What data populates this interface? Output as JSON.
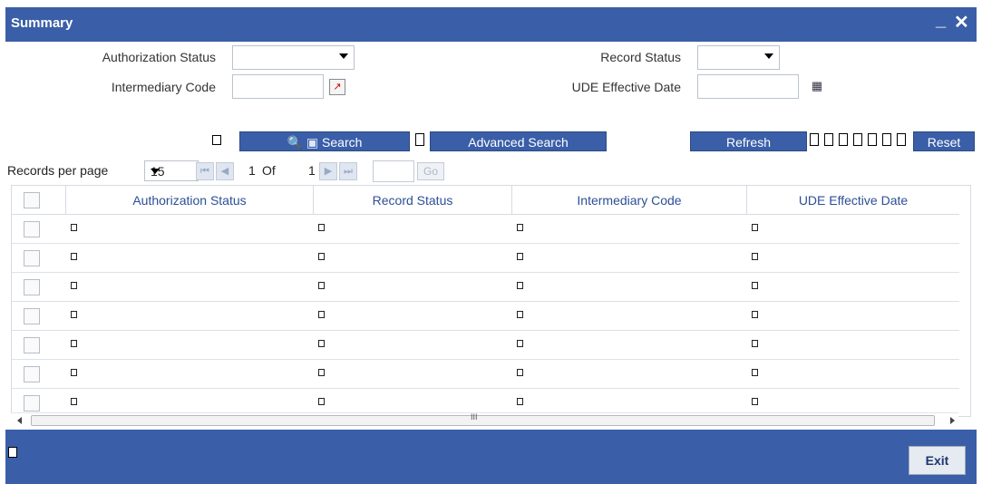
{
  "window": {
    "title": "Summary"
  },
  "filters": {
    "auth_status_label": "Authorization Status",
    "record_status_label": "Record Status",
    "intermediary_code_label": "Intermediary Code",
    "ude_effective_date_label": "UDE Effective Date"
  },
  "toolbar": {
    "search_label": "Search",
    "advanced_search_label": "Advanced Search",
    "refresh_label": "Refresh",
    "reset_label": "Reset"
  },
  "pager": {
    "records_per_page_label": "Records per page",
    "per_page_value": "15",
    "current_page": "1",
    "of_label": "Of",
    "total_pages": "1",
    "go_label": "Go"
  },
  "table": {
    "columns": [
      "Authorization Status",
      "Record Status",
      "Intermediary Code",
      "UDE Effective Date"
    ],
    "empty_rows": 7
  },
  "footer": {
    "exit_label": "Exit"
  },
  "colors": {
    "header_blue": "#3a5fa8",
    "column_header_text": "#2c4f95"
  },
  "icons": [
    "minimize-icon",
    "close-icon",
    "dropdown-arrow-icon",
    "lov-picker-icon",
    "calendar-icon",
    "search-icon",
    "first-page-icon",
    "prev-page-icon",
    "next-page-icon",
    "last-page-icon"
  ]
}
